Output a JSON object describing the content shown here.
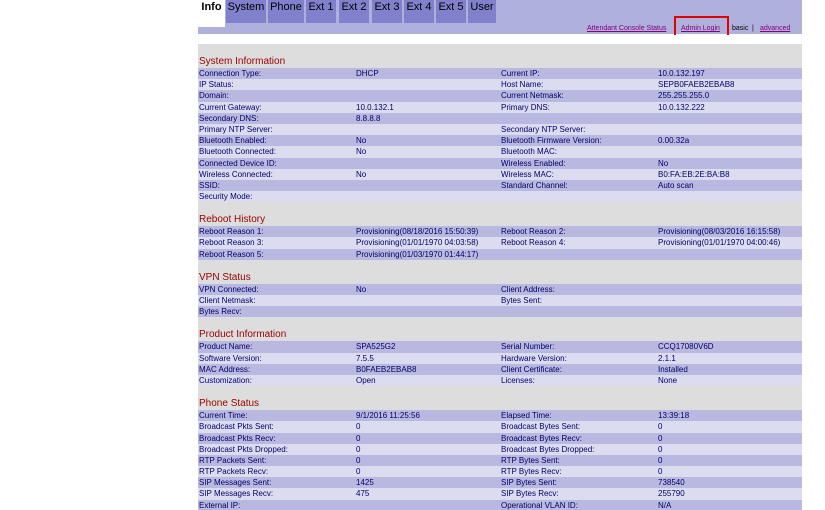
{
  "tabs": [
    {
      "label": "Info",
      "active": true
    },
    {
      "label": "System"
    },
    {
      "label": "Phone"
    },
    {
      "label": "Ext 1"
    },
    {
      "label": "Ext 2"
    },
    {
      "label": "Ext 3"
    },
    {
      "label": "Ext 4"
    },
    {
      "label": "Ext 5"
    },
    {
      "label": "User"
    }
  ],
  "toplinks": {
    "attendant_console_status": "Attendant Console Status",
    "admin_login": "Admin Login",
    "basic": "basic",
    "separator": "|",
    "advanced": "advanced"
  },
  "sections": [
    {
      "title": "System Information",
      "rows": [
        [
          "Connection Type:",
          "DHCP",
          "Current IP:",
          "10.0.132.197"
        ],
        [
          "IP Status:",
          "",
          "Host Name:",
          "SEPB0FAEB2EBAB8"
        ],
        [
          "Domain:",
          "",
          "Current Netmask:",
          "255.255.255.0"
        ],
        [
          "Current Gateway:",
          "10.0.132.1",
          "Primary DNS:",
          "10.0.132.222"
        ],
        [
          "Secondary DNS:",
          "8.8.8.8",
          "",
          ""
        ],
        [
          "Primary NTP Server:",
          "",
          "Secondary NTP Server:",
          ""
        ],
        [
          "Bluetooth Enabled:",
          "No",
          "Bluetooth Firmware Version:",
          "0.00.32a"
        ],
        [
          "Bluetooth Connected:",
          "No",
          "Bluetooth MAC:",
          ""
        ],
        [
          "Connected Device ID:",
          "",
          "Wireless Enabled:",
          "No"
        ],
        [
          "Wireless Connected:",
          "No",
          "Wireless MAC:",
          "B0:FA:EB:2E:BA:B8"
        ],
        [
          "SSID:",
          "",
          "Standard Channel:",
          "Auto scan"
        ],
        [
          "Security Mode:",
          "",
          "",
          ""
        ]
      ]
    },
    {
      "title": "Reboot History",
      "rows": [
        [
          "Reboot Reason 1:",
          "Provisioning(08/18/2016 15:50:39)",
          "Reboot Reason 2:",
          "Provisioning(08/03/2016 16:15:58)"
        ],
        [
          "Reboot Reason 3:",
          "Provisioning(01/01/1970 04:03:58)",
          "Reboot Reason 4:",
          "Provisioning(01/01/1970 04:00:46)"
        ],
        [
          "Reboot Reason 5:",
          "Provisioning(01/03/1970 01:44:17)",
          "",
          ""
        ]
      ]
    },
    {
      "title": "VPN Status",
      "rows": [
        [
          "VPN Connected:",
          "No",
          "Client Address:",
          ""
        ],
        [
          "Client Netmask:",
          "",
          "Bytes Sent:",
          ""
        ],
        [
          "Bytes Recv:",
          "",
          "",
          ""
        ]
      ]
    },
    {
      "title": "Product Information",
      "rows": [
        [
          "Product Name:",
          "SPA525G2",
          "Serial Number:",
          "CCQ17080V6D"
        ],
        [
          "Software Version:",
          "7.5.5",
          "Hardware Version:",
          "2.1.1"
        ],
        [
          "MAC Address:",
          "B0FAEB2EBAB8",
          "Client Certificate:",
          "Installed"
        ],
        [
          "Customization:",
          "Open",
          "Licenses:",
          "None"
        ]
      ]
    },
    {
      "title": "Phone Status",
      "rows": [
        [
          "Current Time:",
          "9/1/2016 11:25:56",
          "Elapsed Time:",
          "13:39:18"
        ],
        [
          "Broadcast Pkts Sent:",
          "0",
          "Broadcast Bytes Sent:",
          "0"
        ],
        [
          "Broadcast Pkts Recv:",
          "0",
          "Broadcast Bytes Recv:",
          "0"
        ],
        [
          "Broadcast Pkts Dropped:",
          "0",
          "Broadcast Bytes Dropped:",
          "0"
        ],
        [
          "RTP Packets Sent:",
          "0",
          "RTP Bytes Sent:",
          "0"
        ],
        [
          "RTP Packets Recv:",
          "0",
          "RTP Bytes Recv:",
          "0"
        ],
        [
          "SIP Messages Sent:",
          "1425",
          "SIP Bytes Sent:",
          "738540"
        ],
        [
          "SIP Messages Recv:",
          "475",
          "SIP Bytes Recv:",
          "255790"
        ],
        [
          "External IP:",
          "",
          "Operational VLAN ID:",
          "N/A"
        ]
      ]
    }
  ]
}
